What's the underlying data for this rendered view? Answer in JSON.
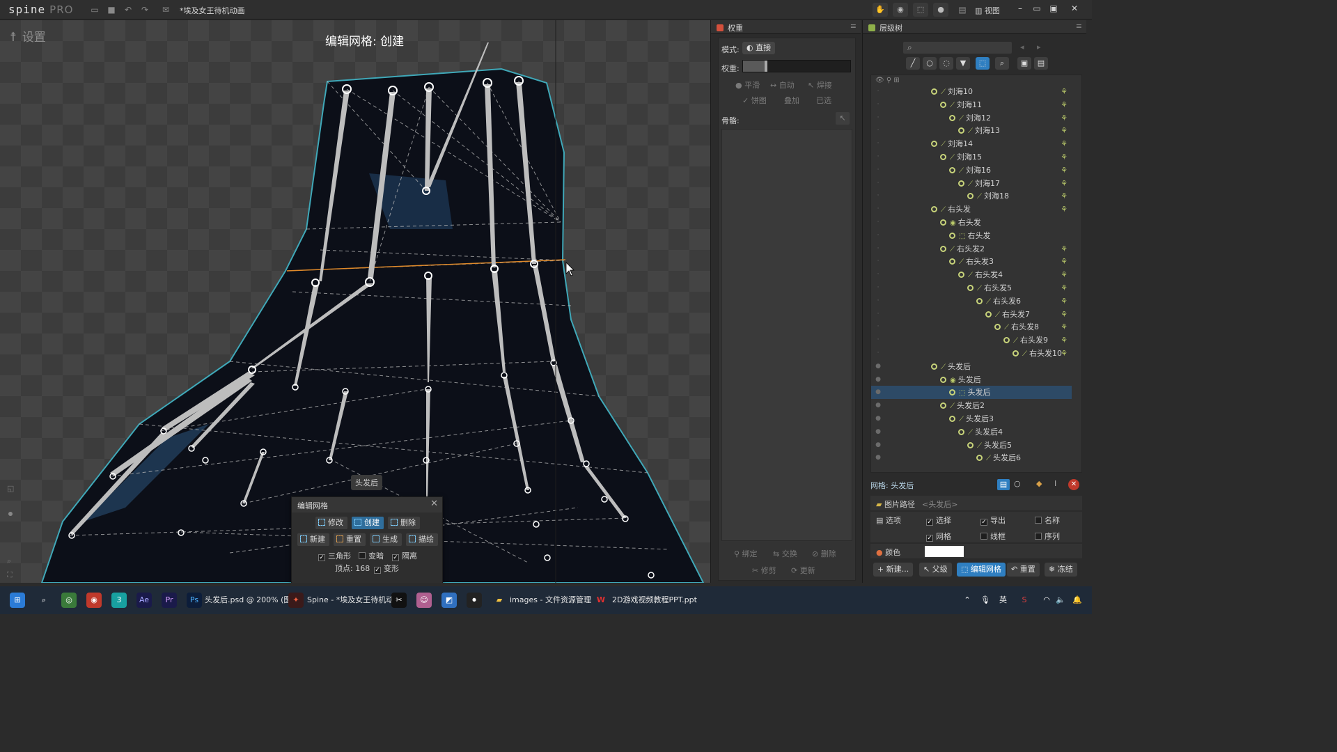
{
  "app": {
    "logo": "spine",
    "edition": "PRO",
    "document_title": "*埃及女王待机动画",
    "view_menu": "视图"
  },
  "viewport": {
    "setup_label": "设置",
    "mode_title": "编辑网格: 创建",
    "mesh_tag": "头发后"
  },
  "edit_mesh": {
    "title": "编辑网格",
    "buttons": {
      "modify": "修改",
      "create": "创建",
      "delete": "删除",
      "new": "新建",
      "reset": "重置",
      "generate": "生成",
      "trace": "描绘"
    },
    "checks": {
      "triangles": "三角形",
      "dim": "变暗",
      "isolate": "隔离",
      "deform": "变形"
    },
    "vertices": "顶点: 168"
  },
  "weights_panel": {
    "title": "权重",
    "mode_label": "模式:",
    "mode_value": "直接",
    "weight_label": "权重:",
    "weight_value": 0.2,
    "smooth": "平滑",
    "auto": "自动",
    "weld": "焊接",
    "pie": "饼图",
    "overlay": "叠加",
    "selected": "已选",
    "bones_label": "骨骼:",
    "bind": "绑定",
    "swap": "交换",
    "remove": "删除",
    "prune": "修剪",
    "update": "更新"
  },
  "tree_panel": {
    "title": "层级树",
    "items": [
      {
        "label": "刘海10",
        "indent": 0,
        "kind": "bone"
      },
      {
        "label": "刘海11",
        "indent": 1,
        "kind": "bone"
      },
      {
        "label": "刘海12",
        "indent": 2,
        "kind": "bone"
      },
      {
        "label": "刘海13",
        "indent": 3,
        "kind": "bone"
      },
      {
        "label": "刘海14",
        "indent": 0,
        "kind": "bone"
      },
      {
        "label": "刘海15",
        "indent": 1,
        "kind": "bone"
      },
      {
        "label": "刘海16",
        "indent": 2,
        "kind": "bone"
      },
      {
        "label": "刘海17",
        "indent": 3,
        "kind": "bone"
      },
      {
        "label": "刘海18",
        "indent": 4,
        "kind": "bone"
      },
      {
        "label": "右头发",
        "indent": 0,
        "kind": "bone"
      },
      {
        "label": "右头发",
        "indent": 1,
        "kind": "slot"
      },
      {
        "label": "右头发",
        "indent": 2,
        "kind": "mesh"
      },
      {
        "label": "右头发2",
        "indent": 1,
        "kind": "bone"
      },
      {
        "label": "右头发3",
        "indent": 2,
        "kind": "bone"
      },
      {
        "label": "右头发4",
        "indent": 3,
        "kind": "bone"
      },
      {
        "label": "右头发5",
        "indent": 4,
        "kind": "bone"
      },
      {
        "label": "右头发6",
        "indent": 5,
        "kind": "bone"
      },
      {
        "label": "右头发7",
        "indent": 6,
        "kind": "bone"
      },
      {
        "label": "右头发8",
        "indent": 7,
        "kind": "bone"
      },
      {
        "label": "右头发9",
        "indent": 8,
        "kind": "bone"
      },
      {
        "label": "右头发10",
        "indent": 9,
        "kind": "bone"
      },
      {
        "label": "头发后",
        "indent": 0,
        "kind": "bone"
      },
      {
        "label": "头发后",
        "indent": 1,
        "kind": "slot"
      },
      {
        "label": "头发后",
        "indent": 2,
        "kind": "mesh",
        "selected": true
      },
      {
        "label": "头发后2",
        "indent": 1,
        "kind": "bone"
      },
      {
        "label": "头发后3",
        "indent": 2,
        "kind": "bone"
      },
      {
        "label": "头发后4",
        "indent": 3,
        "kind": "bone"
      },
      {
        "label": "头发后5",
        "indent": 4,
        "kind": "bone"
      },
      {
        "label": "头发后6",
        "indent": 5,
        "kind": "bone"
      }
    ]
  },
  "properties": {
    "title": "网格: 头发后",
    "image_path_label": "图片路径",
    "image_path_value": "<头发后>",
    "options_label": "选项",
    "opt_select": "选择",
    "opt_export": "导出",
    "opt_name": "名称",
    "opt_mesh": "网格",
    "opt_wire": "线框",
    "opt_sequence": "序列",
    "color_label": "颜色",
    "btn_new": "新建...",
    "btn_parent": "父级",
    "btn_edit_mesh": "编辑网格",
    "btn_reset": "重置",
    "btn_freeze": "冻结"
  },
  "taskbar": {
    "items": [
      "头发后.psd @ 200% (图",
      "Spine - *埃及女王待机动",
      "images - 文件资源管理",
      "2D游戏视频教程PPT.ppt"
    ],
    "ime": "英"
  }
}
